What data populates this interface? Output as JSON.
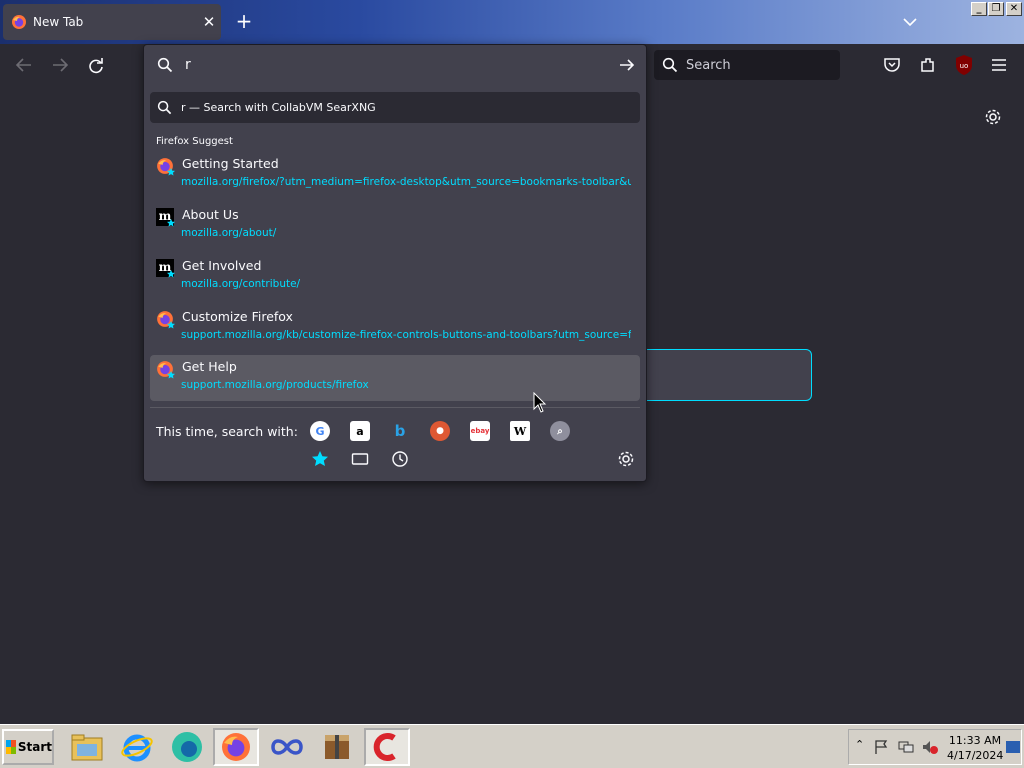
{
  "browser": {
    "tab": {
      "title": "New Tab",
      "close": "✕"
    },
    "new_tab": "+",
    "toolbar_search_placeholder": "Search"
  },
  "urlbar": {
    "value": "r",
    "heuristic": "r — Search with CollabVM SearXNG",
    "group_label": "Firefox Suggest",
    "results": [
      {
        "title": "Getting Started",
        "url": "mozilla.org/firefox/?utm_medium=firefox-desktop&utm_source=bookmarks-toolbar&utm_ca",
        "icon": "firefox-icon",
        "selected": false
      },
      {
        "title": "About Us",
        "url": "mozilla.org/about/",
        "icon": "mozilla-m-icon",
        "selected": false
      },
      {
        "title": "Get Involved",
        "url": "mozilla.org/contribute/",
        "icon": "mozilla-m-icon",
        "selected": false
      },
      {
        "title": "Customize Firefox",
        "url": "support.mozilla.org/kb/customize-firefox-controls-buttons-and-toolbars?utm_source=firefo",
        "icon": "firefox-icon",
        "selected": false
      },
      {
        "title": "Get Help",
        "url": "support.mozilla.org/products/firefox",
        "icon": "firefox-icon",
        "selected": true
      }
    ],
    "oneoff_label": "This time, search with:",
    "engines": [
      "google-icon",
      "amazon-icon",
      "bing-icon",
      "duckduckgo-icon",
      "ebay-icon",
      "wikipedia-icon",
      "searxng-icon"
    ],
    "modes": [
      "bookmarks-star-icon",
      "tabs-icon",
      "history-icon"
    ]
  },
  "taskbar": {
    "start_label": "Start",
    "apps": [
      "file-explorer-icon",
      "internet-explorer-icon",
      "edge-icon",
      "firefox-icon",
      "infinity-icon",
      "archive-icon",
      "ccleaner-icon"
    ],
    "time": "11:33 AM",
    "date": "4/17/2024"
  },
  "colors": {
    "accent": "#00ddff",
    "popup_bg": "#42414d",
    "toolbar_bg": "#2b2a33"
  }
}
